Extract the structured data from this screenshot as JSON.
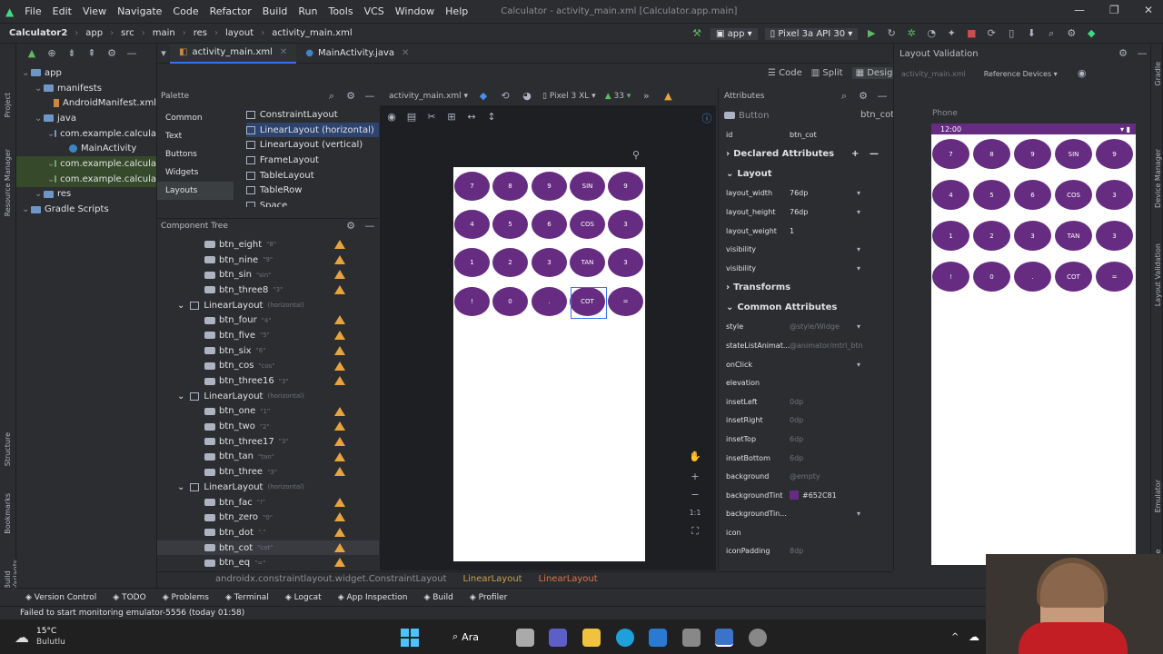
{
  "menu": [
    "File",
    "Edit",
    "View",
    "Navigate",
    "Code",
    "Refactor",
    "Build",
    "Run",
    "Tools",
    "VCS",
    "Window",
    "Help"
  ],
  "window_title": "Calculator - activity_main.xml [Calculator.app.main]",
  "breadcrumb": [
    "Calculator2",
    "app",
    "src",
    "main",
    "res",
    "layout",
    "activity_main.xml"
  ],
  "run_config": "app",
  "device_select": "Pixel 3a API 30",
  "editor_tabs": [
    {
      "label": "activity_main.xml",
      "active": true
    },
    {
      "label": "MainActivity.java",
      "active": false
    }
  ],
  "project_tree": [
    {
      "label": "app",
      "indent": 0,
      "icon": "folder"
    },
    {
      "label": "manifests",
      "indent": 1,
      "icon": "folder"
    },
    {
      "label": "AndroidManifest.xml",
      "indent": 2,
      "icon": "xml"
    },
    {
      "label": "java",
      "indent": 1,
      "icon": "folder"
    },
    {
      "label": "com.example.calcula",
      "indent": 2,
      "icon": "folder"
    },
    {
      "label": "MainActivity",
      "indent": 3,
      "icon": "java"
    },
    {
      "label": "com.example.calcula",
      "indent": 2,
      "icon": "folder-green",
      "hl": true
    },
    {
      "label": "com.example.calcula",
      "indent": 2,
      "icon": "folder-green",
      "hl": true
    },
    {
      "label": "res",
      "indent": 1,
      "icon": "folder"
    },
    {
      "label": "Gradle Scripts",
      "indent": 0,
      "icon": "gradle"
    }
  ],
  "view_modes": [
    "Code",
    "Split",
    "Design"
  ],
  "palette": {
    "title": "Palette",
    "categories": [
      "Common",
      "Text",
      "Buttons",
      "Widgets",
      "Layouts"
    ],
    "items": [
      "ConstraintLayout",
      "LinearLayout (horizontal)",
      "LinearLayout (vertical)",
      "FrameLayout",
      "TableLayout",
      "TableRow",
      "Space"
    ]
  },
  "design_toolbar": {
    "file": "activity_main.xml",
    "device": "Pixel 3 XL",
    "api": "33"
  },
  "component_tree": {
    "title": "Component Tree",
    "rows": [
      {
        "label": "btn_eight",
        "hint": "\"8\"",
        "type": "button",
        "warn": true
      },
      {
        "label": "btn_nine",
        "hint": "\"9\"",
        "type": "button",
        "warn": true
      },
      {
        "label": "btn_sin",
        "hint": "\"sin\"",
        "type": "button",
        "warn": true
      },
      {
        "label": "btn_three8",
        "hint": "\"3\"",
        "type": "button",
        "warn": true
      },
      {
        "label": "LinearLayout",
        "hint": "(horizontal)",
        "type": "layout",
        "warn": false
      },
      {
        "label": "btn_four",
        "hint": "\"4\"",
        "type": "button",
        "warn": true
      },
      {
        "label": "btn_five",
        "hint": "\"5\"",
        "type": "button",
        "warn": true
      },
      {
        "label": "btn_six",
        "hint": "\"6\"",
        "type": "button",
        "warn": true
      },
      {
        "label": "btn_cos",
        "hint": "\"cos\"",
        "type": "button",
        "warn": true
      },
      {
        "label": "btn_three16",
        "hint": "\"3\"",
        "type": "button",
        "warn": true
      },
      {
        "label": "LinearLayout",
        "hint": "(horizontal)",
        "type": "layout",
        "warn": false
      },
      {
        "label": "btn_one",
        "hint": "\"1\"",
        "type": "button",
        "warn": true
      },
      {
        "label": "btn_two",
        "hint": "\"2\"",
        "type": "button",
        "warn": true
      },
      {
        "label": "btn_three17",
        "hint": "\"3\"",
        "type": "button",
        "warn": true
      },
      {
        "label": "btn_tan",
        "hint": "\"tan\"",
        "type": "button",
        "warn": true
      },
      {
        "label": "btn_three",
        "hint": "\"3\"",
        "type": "button",
        "warn": true
      },
      {
        "label": "LinearLayout",
        "hint": "(horizontal)",
        "type": "layout",
        "warn": false
      },
      {
        "label": "btn_fac",
        "hint": "\"!\"",
        "type": "button",
        "warn": true
      },
      {
        "label": "btn_zero",
        "hint": "\"0\"",
        "type": "button",
        "warn": true
      },
      {
        "label": "btn_dot",
        "hint": "\".\"",
        "type": "button",
        "warn": true
      },
      {
        "label": "btn_cot",
        "hint": "\"cot\"",
        "type": "button",
        "warn": true,
        "selected": true
      },
      {
        "label": "btn_eq",
        "hint": "\"=\"",
        "type": "button",
        "warn": true
      }
    ]
  },
  "calc_rows": [
    [
      "7",
      "8",
      "9",
      "SIN",
      "9"
    ],
    [
      "4",
      "5",
      "6",
      "COS",
      "3"
    ],
    [
      "1",
      "2",
      "3",
      "TAN",
      "3"
    ],
    [
      "!",
      "0",
      ".",
      "COT",
      "="
    ]
  ],
  "button_color": "#652C81",
  "attributes": {
    "title": "Attributes",
    "widget": "Button",
    "widget_id": "btn_cot",
    "id_label": "id",
    "id_value": "btn_cot",
    "sections": [
      "Declared Attributes",
      "Layout",
      "Transforms",
      "Common Attributes"
    ],
    "layout_rows": [
      {
        "label": "layout_width",
        "value": "76dp",
        "dim": false
      },
      {
        "label": "layout_height",
        "value": "76dp",
        "dim": false
      },
      {
        "label": "layout_weight",
        "value": "1",
        "dim": false
      },
      {
        "label": "visibility",
        "value": "",
        "dim": false
      },
      {
        "label": "visibility",
        "value": "",
        "dim": false
      }
    ],
    "common_rows": [
      {
        "label": "style",
        "value": "@style/Widge",
        "dim": true
      },
      {
        "label": "stateListAnimat...",
        "value": "@animator/mtrl_btn",
        "dim": true
      },
      {
        "label": "onClick",
        "value": "",
        "dim": false
      },
      {
        "label": "elevation",
        "value": "",
        "dim": false
      },
      {
        "label": "insetLeft",
        "value": "0dp",
        "dim": true
      },
      {
        "label": "insetRight",
        "value": "0dp",
        "dim": true
      },
      {
        "label": "insetTop",
        "value": "6dp",
        "dim": true
      },
      {
        "label": "insetBottom",
        "value": "6dp",
        "dim": true
      },
      {
        "label": "background",
        "value": "@empty",
        "dim": true
      },
      {
        "label": "backgroundTint",
        "value": "#652C81",
        "dim": false
      },
      {
        "label": "backgroundTin...",
        "value": "",
        "dim": false
      },
      {
        "label": "icon",
        "value": "",
        "dim": false
      },
      {
        "label": "iconPadding",
        "value": "8dp",
        "dim": true
      }
    ]
  },
  "validation": {
    "title": "Layout Validation",
    "ref": "Reference Devices",
    "file": "activity_main.xml",
    "phone_label": "Phone",
    "time": "12:00"
  },
  "bottom_breadcrumb": [
    "androidx.constraintlayout.widget.ConstraintLayout",
    "LinearLayout",
    "LinearLayout"
  ],
  "tool_windows": [
    "Version Control",
    "TODO",
    "Problems",
    "Terminal",
    "Logcat",
    "App Inspection",
    "Build",
    "Profiler"
  ],
  "status_text": "Failed to start monitoring emulator-5556 (today 01:58)",
  "weather": {
    "temp": "15°C",
    "desc": "Bulutlu"
  },
  "search_label": "Ara"
}
